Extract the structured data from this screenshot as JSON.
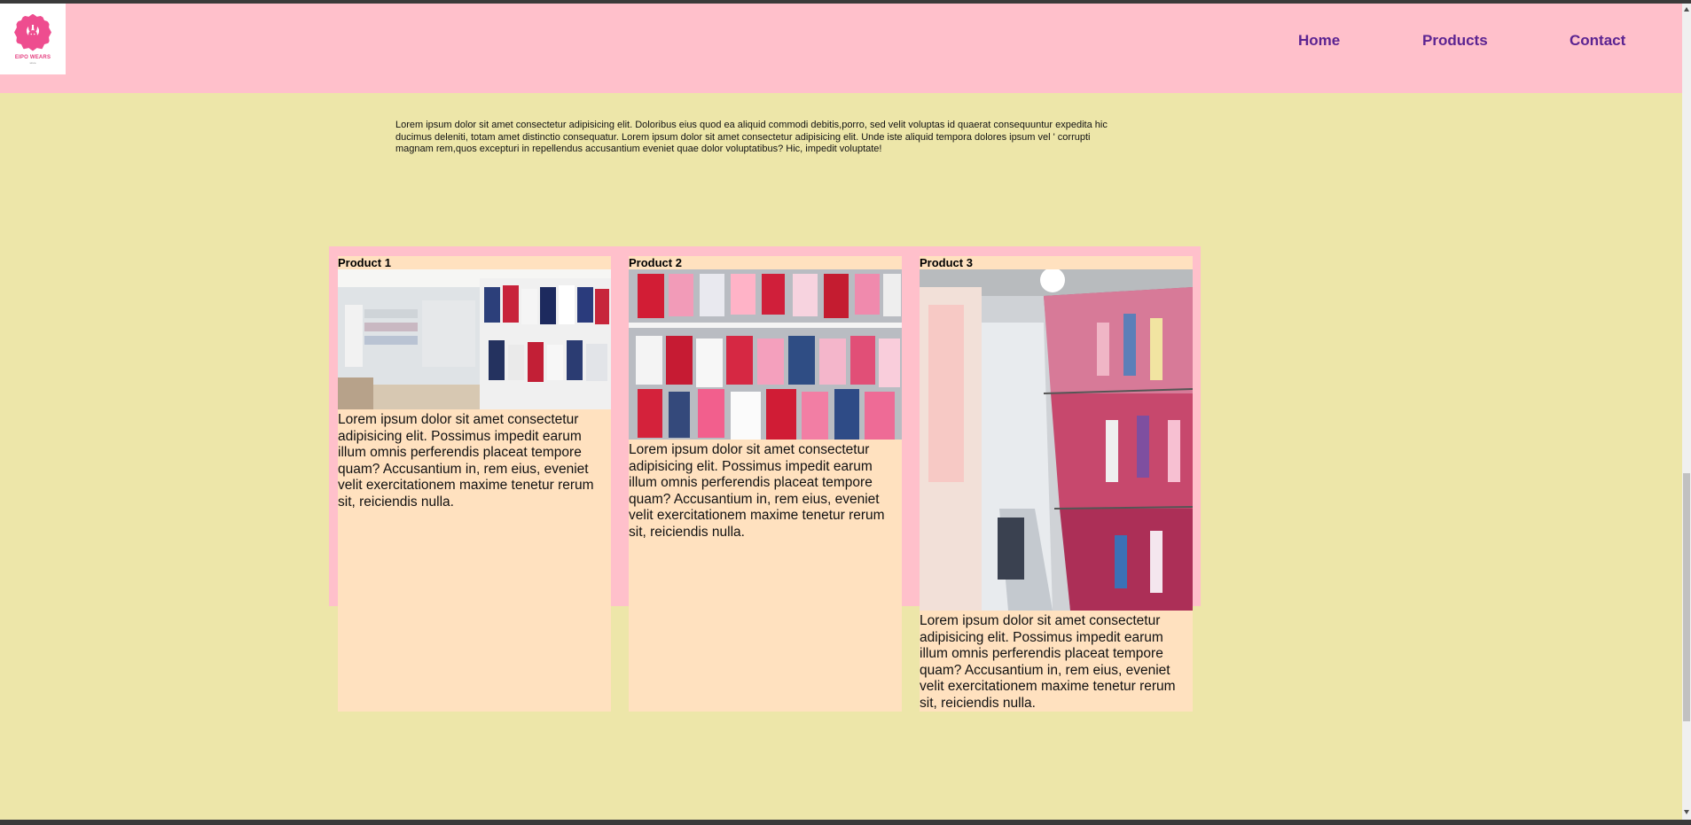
{
  "header": {
    "logo": {
      "name": "EIPO WEARS",
      "tagline": "since"
    },
    "nav": [
      {
        "label": "Home"
      },
      {
        "label": "Products"
      },
      {
        "label": "Contact"
      }
    ]
  },
  "intro": {
    "text": "Lorem ipsum dolor sit amet consectetur adipisicing elit. Doloribus eius quod ea aliquid commodi debitis,porro, sed velit voluptas id quaerat consequuntur expedita hic ducimus deleniti, totam amet distinctio consequatur. Lorem ipsum dolor sit amet consectetur adipisicing elit. Unde iste aliquid tempora dolores ipsum vel ' corrupti magnam rem,quos excepturi in repellendus accusantium eveniet quae dolor voluptatibus? Hic, impedit voluptate!"
  },
  "products": [
    {
      "title": "Product 1",
      "image": "store-interior-photo",
      "description": "Lorem ipsum dolor sit amet consectetur adipisicing elit. Possimus impedit earum illum omnis perferendis placeat tempore quam? Accusantium in, rem eius, eveniet velit exercitationem maxime tenetur rerum sit, reiciendis nulla."
    },
    {
      "title": "Product 2",
      "image": "hanging-baby-clothes-photo",
      "description": "Lorem ipsum dolor sit amet consectetur adipisicing elit. Possimus impedit earum illum omnis perferendis placeat tempore quam? Accusantium in, rem eius, eveniet velit exercitationem maxime tenetur rerum sit, reiciendis nulla."
    },
    {
      "title": "Product 3",
      "image": "clothing-rack-aisle-photo",
      "description": "Lorem ipsum dolor sit amet consectetur adipisicing elit. Possimus impedit earum illum omnis perferendis placeat tempore quam? Accusantium in, rem eius, eveniet velit exercitationem maxime tenetur rerum sit, reiciendis nulla."
    }
  ],
  "colors": {
    "page_background": "#ede6a9",
    "header_background": "#ffc0cb",
    "card_background": "#ffe1bf",
    "nav_link": "#5b2391"
  }
}
